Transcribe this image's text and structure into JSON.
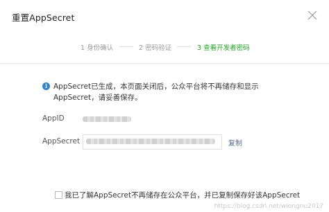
{
  "dialog": {
    "title": "重置AppSecret",
    "close_icon": "close-icon"
  },
  "steps": [
    {
      "label": "1 身份确认",
      "active": false
    },
    {
      "label": "2 密码验证",
      "active": false
    },
    {
      "label": "3 查看开发者密码",
      "active": true
    }
  ],
  "notice": {
    "icon": "info-icon",
    "icon_glyph": "i",
    "text": "AppSecret已生成，本页面关闭后，公众平台将不再储存和显示AppSecret，请妥善保存。"
  },
  "fields": {
    "appid_label": "AppID",
    "appsecret_label": "AppSecret",
    "copy_label": "复制"
  },
  "confirm": {
    "label": "我已了解AppSecret不再储存在公众平台，并已复制保存好该AppSecret",
    "checked": false
  },
  "watermark": "https://blog.csdn.net/wiongnu2017",
  "colors": {
    "accent_green": "#1aad19",
    "info_blue": "#2e82d8",
    "link_blue": "#576b95"
  }
}
